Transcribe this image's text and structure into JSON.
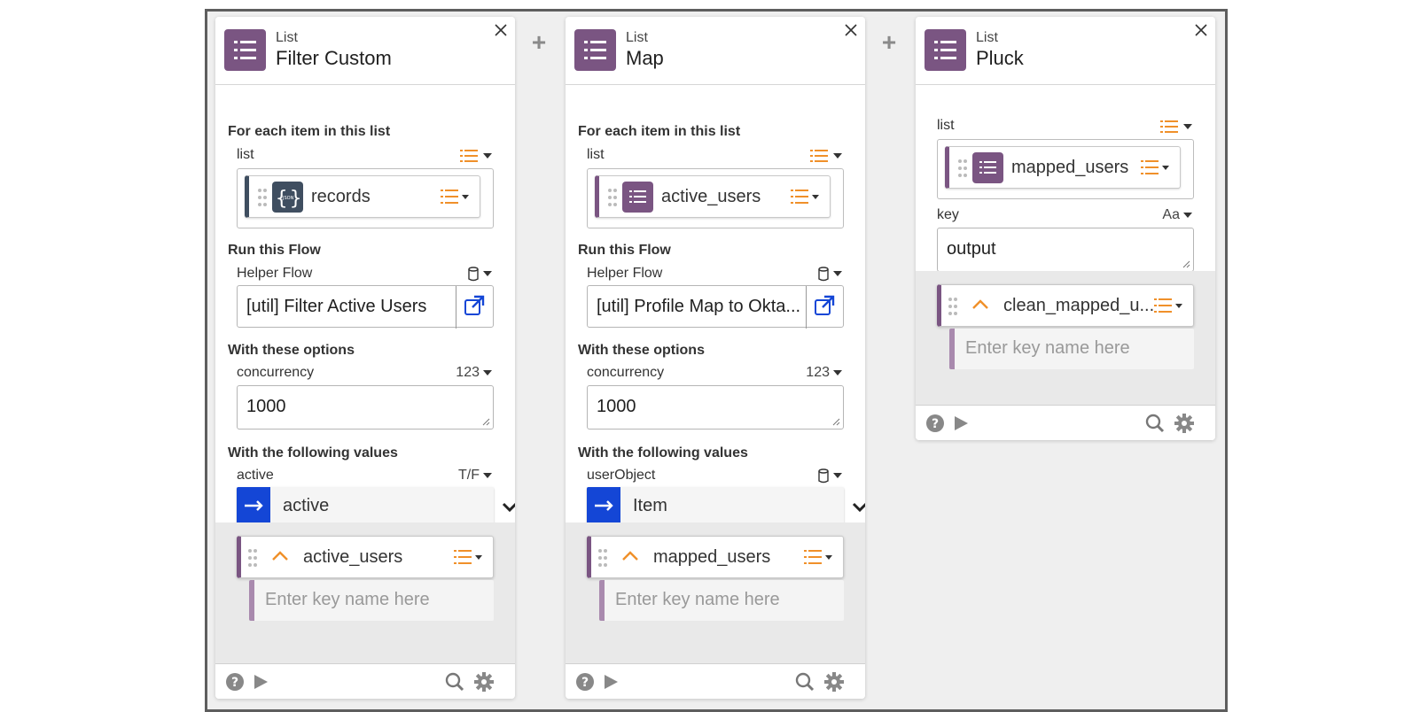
{
  "colors": {
    "list_purple": "#7a5582",
    "json_slate": "#3f4e60",
    "accent_orange": "#f0902a",
    "link_blue": "#1446d6",
    "map_blue": "#1446d6"
  },
  "cards": [
    {
      "type": "List",
      "title": "Filter Custom",
      "sections": {
        "input_heading": "For each item in this list",
        "flow_heading": "Run this Flow",
        "options_heading": "With these options",
        "values_heading": "With the following values"
      },
      "list_label": "list",
      "list_value": "records",
      "list_value_icon": "json-icon",
      "flow_label": "Helper Flow",
      "flow_value": "[util] Filter Active Users",
      "concurrency_label": "concurrency",
      "concurrency_type": "123",
      "concurrency_value": "1000",
      "param_label": "active",
      "param_type": "T/F",
      "param_value": "active",
      "output_name": "active_users",
      "key_placeholder": "Enter key name here"
    },
    {
      "type": "List",
      "title": "Map",
      "sections": {
        "input_heading": "For each item in this list",
        "flow_heading": "Run this Flow",
        "options_heading": "With these options",
        "values_heading": "With the following values"
      },
      "list_label": "list",
      "list_value": "active_users",
      "list_value_icon": "list-icon",
      "flow_label": "Helper Flow",
      "flow_value": "[util] Profile Map to Okta...",
      "concurrency_label": "concurrency",
      "concurrency_type": "123",
      "concurrency_value": "1000",
      "param_label": "userObject",
      "param_type": "",
      "param_value": "Item",
      "output_name": "mapped_users",
      "key_placeholder": "Enter key name here"
    },
    {
      "type": "List",
      "title": "Pluck",
      "list_label": "list",
      "list_value": "mapped_users",
      "list_value_icon": "list-icon",
      "key_label": "key",
      "key_type": "Aa",
      "key_value": "output",
      "output_name": "clean_mapped_u...",
      "key_placeholder": "Enter key name here"
    }
  ]
}
